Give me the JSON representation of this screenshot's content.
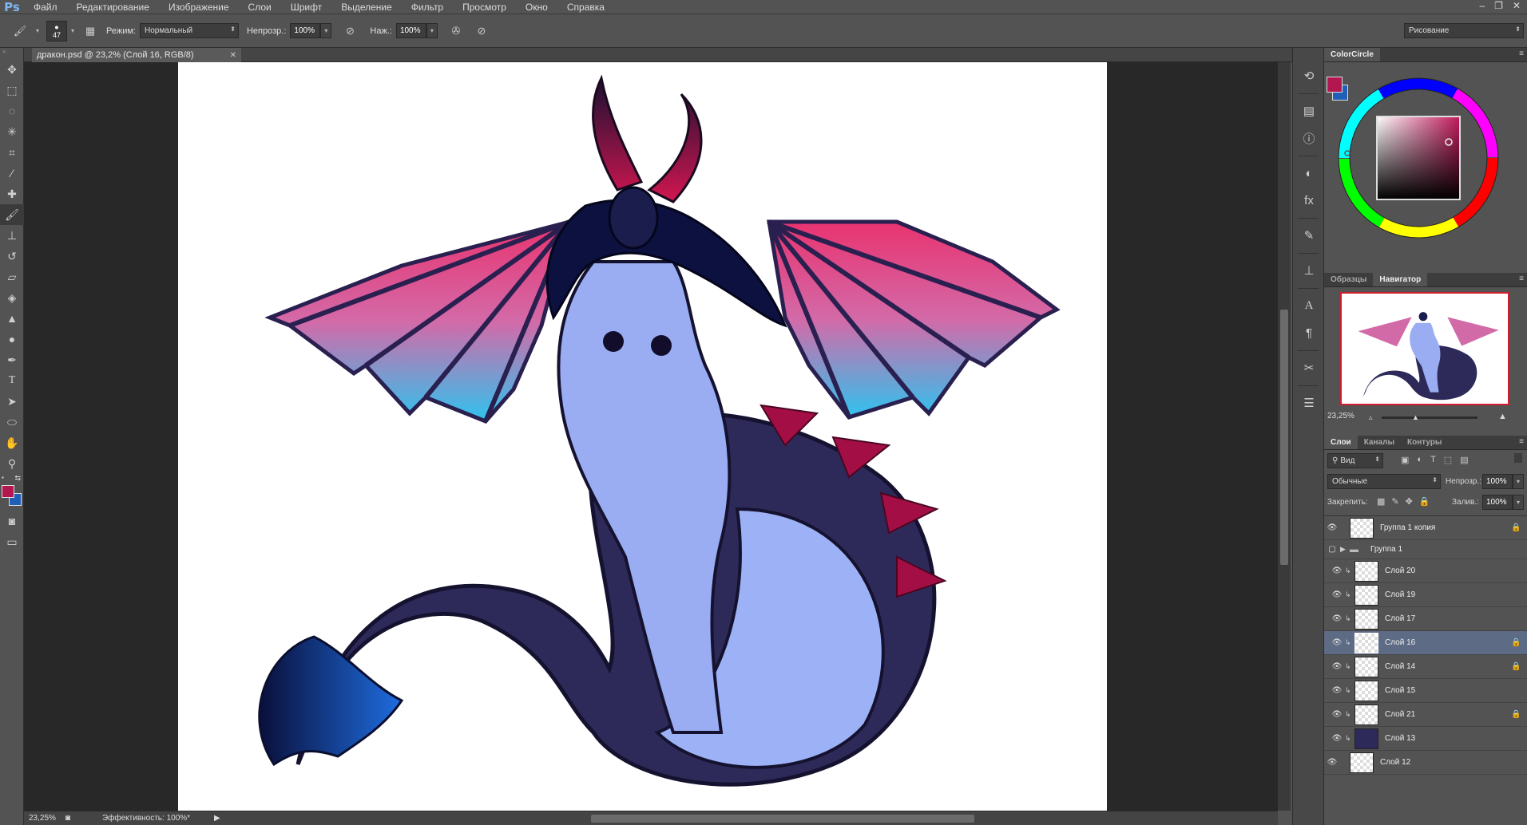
{
  "app": {
    "logo": "Ps"
  },
  "menu": [
    "Файл",
    "Редактирование",
    "Изображение",
    "Слои",
    "Шрифт",
    "Выделение",
    "Фильтр",
    "Просмотр",
    "Окно",
    "Справка"
  ],
  "options": {
    "brush_size": "47",
    "mode_label": "Режим:",
    "mode_value": "Нормальный",
    "opacity_label": "Непрозр.:",
    "opacity_value": "100%",
    "pressure_label": "Наж.:",
    "pressure_value": "100%",
    "workspace": "Рисование"
  },
  "document": {
    "tab_title": "дракон.psd @ 23,2% (Слой 16, RGB/8)",
    "zoom": "23,25%",
    "status": "Эффективность: 100%*"
  },
  "colors": {
    "foreground": "#b2184f",
    "background": "#1f5fb8"
  },
  "panels": {
    "colorcircle_title": "ColorCircle",
    "swatches_tab": "Образцы",
    "navigator_tab": "Навигатор",
    "navigator_zoom": "23,25%",
    "layers_tab": "Слои",
    "channels_tab": "Каналы",
    "paths_tab": "Контуры",
    "filter_label": "Вид",
    "blend_mode": "Обычные",
    "opacity_label": "Непрозр.:",
    "opacity_value": "100%",
    "lock_label": "Закрепить:",
    "fill_label": "Залив.:",
    "fill_value": "100%"
  },
  "layers": [
    {
      "name": "Группа 1 копия",
      "locked": true,
      "visible": true
    },
    {
      "name": "Группа 1",
      "group": true,
      "visible": false
    },
    {
      "name": "Слой 20",
      "visible": true
    },
    {
      "name": "Слой 19",
      "visible": true
    },
    {
      "name": "Слой 17",
      "visible": true
    },
    {
      "name": "Слой 16",
      "visible": true,
      "selected": true,
      "locked": true
    },
    {
      "name": "Слой 14",
      "visible": true,
      "locked": true
    },
    {
      "name": "Слой 15",
      "visible": true
    },
    {
      "name": "Слой 21",
      "visible": true,
      "locked": true
    },
    {
      "name": "Слой 13",
      "visible": true
    },
    {
      "name": "Слой 12",
      "visible": true
    }
  ]
}
